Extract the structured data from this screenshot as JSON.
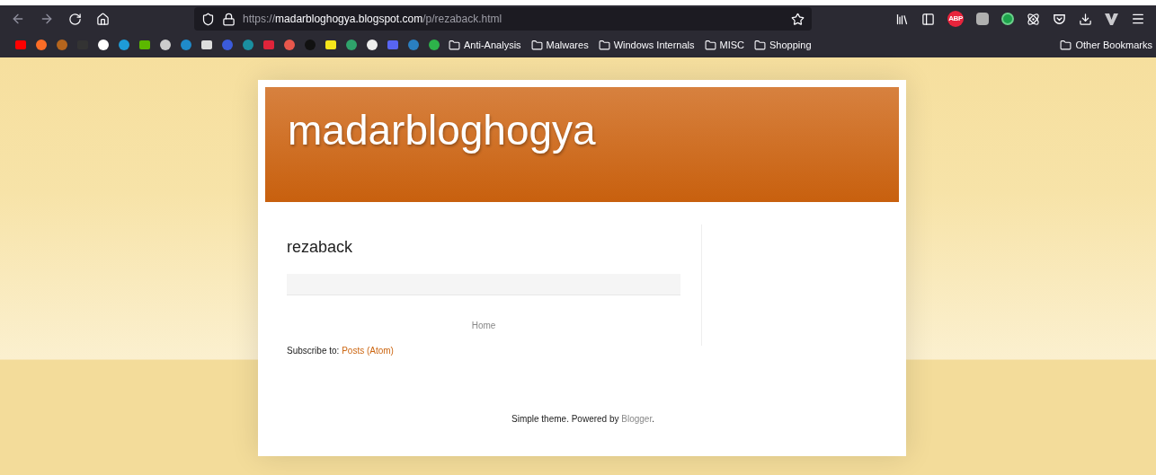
{
  "browser": {
    "url": {
      "scheme": "https://",
      "host": "madarbloghogya.blogspot.com",
      "path": "/p/rezaback.html"
    },
    "bookmark_folders": [
      "Anti-Analysis",
      "Malwares",
      "Windows Internals",
      "MISC",
      "Shopping"
    ],
    "other_bookmarks": "Other Bookmarks",
    "abp_badge": "ABP"
  },
  "blog": {
    "title": "madarbloghogya",
    "page_title": "rezaback",
    "home_link": "Home",
    "subscribe": {
      "text": "Subscribe to: ",
      "link": "Posts (Atom)"
    },
    "footer": {
      "text": "Simple theme. Powered by ",
      "link": "Blogger",
      "end": "."
    }
  }
}
